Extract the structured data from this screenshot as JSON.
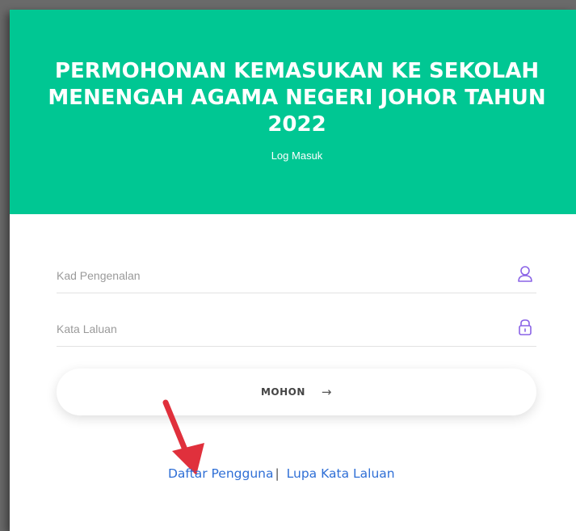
{
  "header": {
    "title": "PERMOHONAN KEMASUKAN KE SEKOLAH MENENGAH AGAMA NEGERI JOHOR TAHUN 2022",
    "subtitle": "Log Masuk",
    "background_color": "#00c793"
  },
  "form": {
    "ic_field": {
      "placeholder": "Kad Pengenalan",
      "value": "",
      "icon": "user-icon"
    },
    "password_field": {
      "placeholder": "Kata Laluan",
      "value": "",
      "icon": "lock-icon"
    },
    "submit": {
      "label": "MOHON",
      "icon": "arrow-right-icon",
      "arrow_glyph": "→"
    }
  },
  "links": {
    "register_label": "Daftar Pengguna",
    "separator": "|",
    "forgot_label": "Lupa Kata Laluan",
    "link_color": "#2f6fd6"
  },
  "annotation": {
    "icon": "red-pointer-arrow-icon",
    "color": "#e0303c"
  },
  "accent_icon_color": "#8a63e6"
}
